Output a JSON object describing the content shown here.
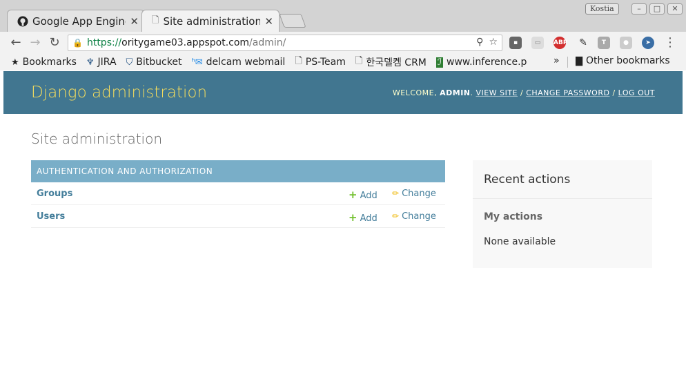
{
  "browser": {
    "tabs": [
      {
        "title": "Google App Engine",
        "icon": "github-icon"
      },
      {
        "title": "Site administration",
        "icon": "page-icon"
      }
    ],
    "window_user": "Kostia",
    "window_buttons": [
      "–",
      "□",
      "✕"
    ],
    "url": {
      "scheme": "https://",
      "host": "oritygame03.appspot.com",
      "path": "/admin/"
    },
    "bookmarks": [
      {
        "label": "Bookmarks",
        "icon": "star-icon"
      },
      {
        "label": "JIRA",
        "icon": "jira-icon"
      },
      {
        "label": "Bitbucket",
        "icon": "bitbucket-icon"
      },
      {
        "label": "delcam webmail",
        "icon": "webmail-icon"
      },
      {
        "label": "PS-Team",
        "icon": "page-icon"
      },
      {
        "label": "한국델켐 CRM",
        "icon": "page-icon"
      },
      {
        "label": "www.inference.p",
        "icon": "inference-icon"
      }
    ],
    "overflow": "»",
    "other_bookmarks": "Other bookmarks",
    "extensions": [
      "pocket-icon",
      "cast-icon",
      "adblock-icon",
      "eyedropper-icon",
      "t-icon",
      "ghost-icon",
      "send-icon"
    ]
  },
  "admin": {
    "branding": "Django administration",
    "user_tools": {
      "welcome": "WELCOME, ",
      "username": "ADMIN",
      "view_site": "VIEW SITE",
      "change_password": "CHANGE PASSWORD",
      "log_out": "LOG OUT"
    },
    "title": "Site administration",
    "module": {
      "caption": "AUTHENTICATION AND AUTHORIZATION",
      "models": [
        {
          "name": "Groups",
          "add": "Add",
          "change": "Change"
        },
        {
          "name": "Users",
          "add": "Add",
          "change": "Change"
        }
      ]
    },
    "recent_actions": {
      "title": "Recent actions",
      "my_actions": "My actions",
      "none": "None available"
    }
  },
  "colors": {
    "header_bg": "#417690",
    "branding": "#f5dd5d",
    "caption_bg": "#79aec8",
    "link": "#447e9b",
    "add_icon": "#70bf2b",
    "change_icon": "#efb80b"
  }
}
